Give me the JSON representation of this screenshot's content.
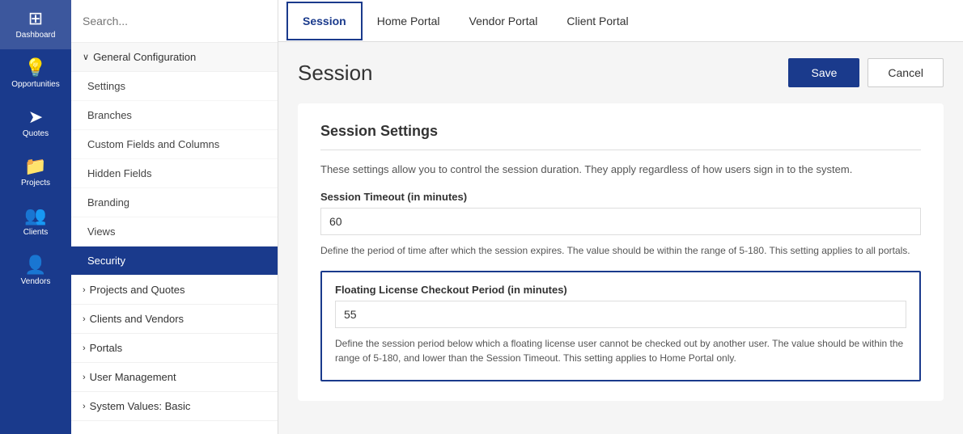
{
  "sidebar": {
    "items": [
      {
        "id": "dashboard",
        "label": "Dashboard",
        "icon": "⊞",
        "active": false
      },
      {
        "id": "opportunities",
        "label": "Opportunities",
        "icon": "💡",
        "active": false
      },
      {
        "id": "quotes",
        "label": "Quotes",
        "icon": "➤",
        "active": false
      },
      {
        "id": "projects",
        "label": "Projects",
        "icon": "📁",
        "active": false
      },
      {
        "id": "clients",
        "label": "Clients",
        "icon": "👥",
        "active": false
      },
      {
        "id": "vendors",
        "label": "Vendors",
        "icon": "👤",
        "active": false
      }
    ]
  },
  "leftMenu": {
    "searchPlaceholder": "Search...",
    "groups": [
      {
        "id": "general-config",
        "label": "General Configuration",
        "expanded": true,
        "chevron": "∨",
        "items": [
          {
            "id": "settings",
            "label": "Settings",
            "active": false
          },
          {
            "id": "branches",
            "label": "Branches",
            "active": false
          },
          {
            "id": "custom-fields",
            "label": "Custom Fields and Columns",
            "active": false
          },
          {
            "id": "hidden-fields",
            "label": "Hidden Fields",
            "active": false
          },
          {
            "id": "branding",
            "label": "Branding",
            "active": false
          },
          {
            "id": "views",
            "label": "Views",
            "active": false
          },
          {
            "id": "security",
            "label": "Security",
            "active": true
          }
        ]
      },
      {
        "id": "projects-quotes",
        "label": "Projects and Quotes",
        "expanded": false,
        "chevron": "›"
      },
      {
        "id": "clients-vendors",
        "label": "Clients and Vendors",
        "expanded": false,
        "chevron": "›"
      },
      {
        "id": "portals",
        "label": "Portals",
        "expanded": false,
        "chevron": "›"
      },
      {
        "id": "user-management",
        "label": "User Management",
        "expanded": false,
        "chevron": "›"
      },
      {
        "id": "system-values",
        "label": "System Values: Basic",
        "expanded": false,
        "chevron": "›"
      }
    ]
  },
  "tabs": [
    {
      "id": "session",
      "label": "Session",
      "active": true
    },
    {
      "id": "home-portal",
      "label": "Home Portal",
      "active": false
    },
    {
      "id": "vendor-portal",
      "label": "Vendor Portal",
      "active": false
    },
    {
      "id": "client-portal",
      "label": "Client Portal",
      "active": false
    }
  ],
  "page": {
    "title": "Session",
    "saveLabel": "Save",
    "cancelLabel": "Cancel"
  },
  "sessionSettings": {
    "cardTitle": "Session Settings",
    "cardDesc": "These settings allow you to control the session duration. They apply regardless of how users sign in to the system.",
    "timeoutLabel": "Session Timeout (in minutes)",
    "timeoutValue": "60",
    "timeoutDesc": "Define the period of time after which the session expires. The value should be within the range of 5-180. This setting applies to all portals.",
    "floatingLabel": "Floating License Checkout Period (in minutes)",
    "floatingValue": "55",
    "floatingDesc": "Define the session period below which a floating license user cannot be checked out by another user. The value should be within the range of 5-180, and lower than the Session Timeout. This setting applies to Home Portal only."
  }
}
